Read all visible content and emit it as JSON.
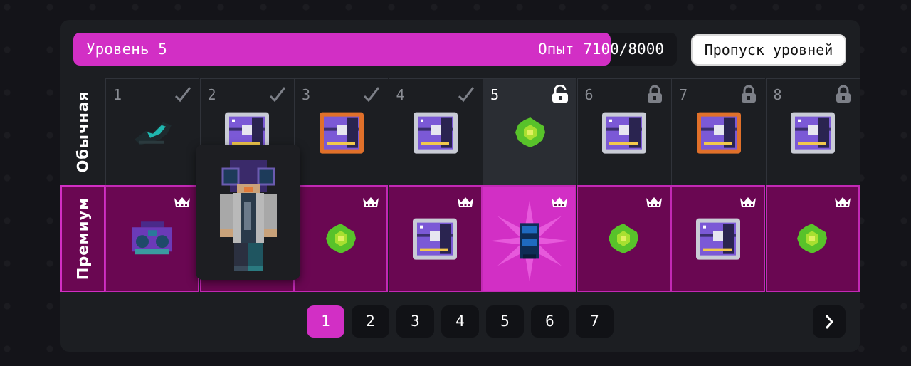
{
  "header": {
    "level_label": "Уровень 5",
    "exp_label": "Опыт 7100/8000",
    "progress": 0.89,
    "skip_button": "Пропуск уровней"
  },
  "rows": {
    "free_label": "Обычная",
    "premium_label": "Премиум"
  },
  "levels": [
    {
      "num": "1",
      "status": "claimed",
      "free_item": "dark-sneaker-item",
      "premium_item": "boombox-item"
    },
    {
      "num": "2",
      "status": "claimed",
      "free_item": "silver-chest-item",
      "premium_item": "skin-preview-item"
    },
    {
      "num": "3",
      "status": "claimed",
      "free_item": "orange-chest-item",
      "premium_item": "green-gem-item"
    },
    {
      "num": "4",
      "status": "claimed",
      "free_item": "silver-chest-item",
      "premium_item": "silver-chest-item"
    },
    {
      "num": "5",
      "status": "unlocked",
      "free_item": "green-gem-item",
      "premium_item": "blue-backpack-item"
    },
    {
      "num": "6",
      "status": "locked",
      "free_item": "silver-chest-item",
      "premium_item": "green-gem-item"
    },
    {
      "num": "7",
      "status": "locked",
      "free_item": "orange-chest-item",
      "premium_item": "silver-chest-item"
    },
    {
      "num": "8",
      "status": "locked",
      "free_item": "silver-chest-item",
      "premium_item": "green-gem-item"
    }
  ],
  "pagination": {
    "pages": [
      "1",
      "2",
      "3",
      "4",
      "5",
      "6",
      "7"
    ],
    "active": "1",
    "next_icon": "chevron-right-icon"
  },
  "colors": {
    "accent": "#d22fc5",
    "premium_bg": "#6a0752",
    "panel_bg": "#1c1e22"
  }
}
